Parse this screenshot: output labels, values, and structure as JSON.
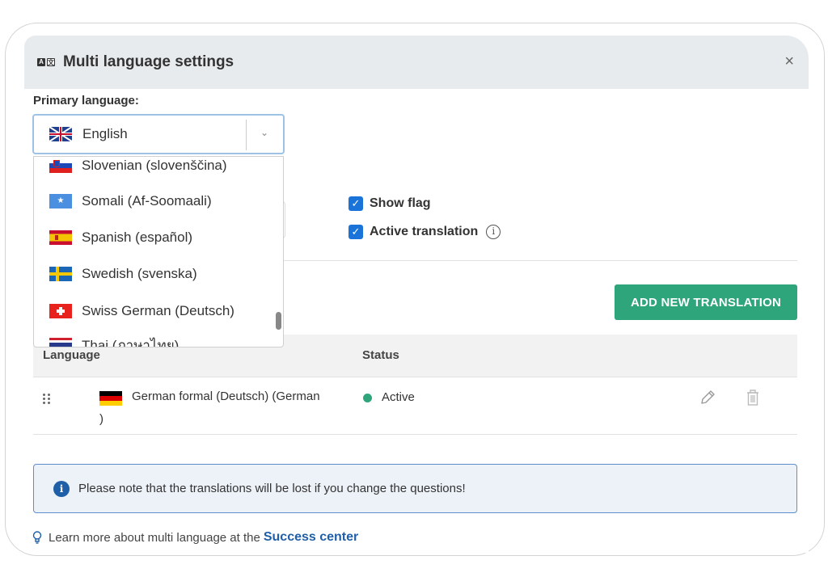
{
  "modal": {
    "title": "Multi language settings",
    "close_symbol": "×"
  },
  "primary_language": {
    "label": "Primary language:",
    "selected": "English",
    "selected_flag": "uk-flag-icon"
  },
  "dropdown": {
    "options": [
      {
        "label": "Slovenian (slovenščina)",
        "flag": "slovenia-flag-icon"
      },
      {
        "label": "Somali (Af-Soomaali)",
        "flag": "somalia-flag-icon"
      },
      {
        "label": "Spanish (español)",
        "flag": "spain-flag-icon"
      },
      {
        "label": "Swedish (svenska)",
        "flag": "sweden-flag-icon"
      },
      {
        "label": "Swiss German (Deutsch)",
        "flag": "switzerland-flag-icon"
      },
      {
        "label": "Thai (ภาษาไทย)",
        "flag": "thailand-flag-icon"
      }
    ]
  },
  "options": {
    "show_flag": {
      "label": "Show flag",
      "checked": true
    },
    "active_translation": {
      "label": "Active translation",
      "checked": true
    }
  },
  "add_translation_label": "ADD NEW TRANSLATION",
  "table": {
    "headers": {
      "language": "Language",
      "status": "Status"
    },
    "rows": [
      {
        "language": "German formal (Deutsch) (German",
        "language_tail": ")",
        "flag": "germany-flag-icon",
        "status": "Active"
      }
    ]
  },
  "notice": {
    "text": "Please note that the translations will be lost if you change the questions!"
  },
  "footer": {
    "text": "Learn more about multi language at the",
    "link": "Success center"
  },
  "colors": {
    "accent_green": "#2ea57a",
    "checkbox_blue": "#1a73d9",
    "link_blue": "#1f5fa8",
    "header_bg": "#e8ebed"
  }
}
